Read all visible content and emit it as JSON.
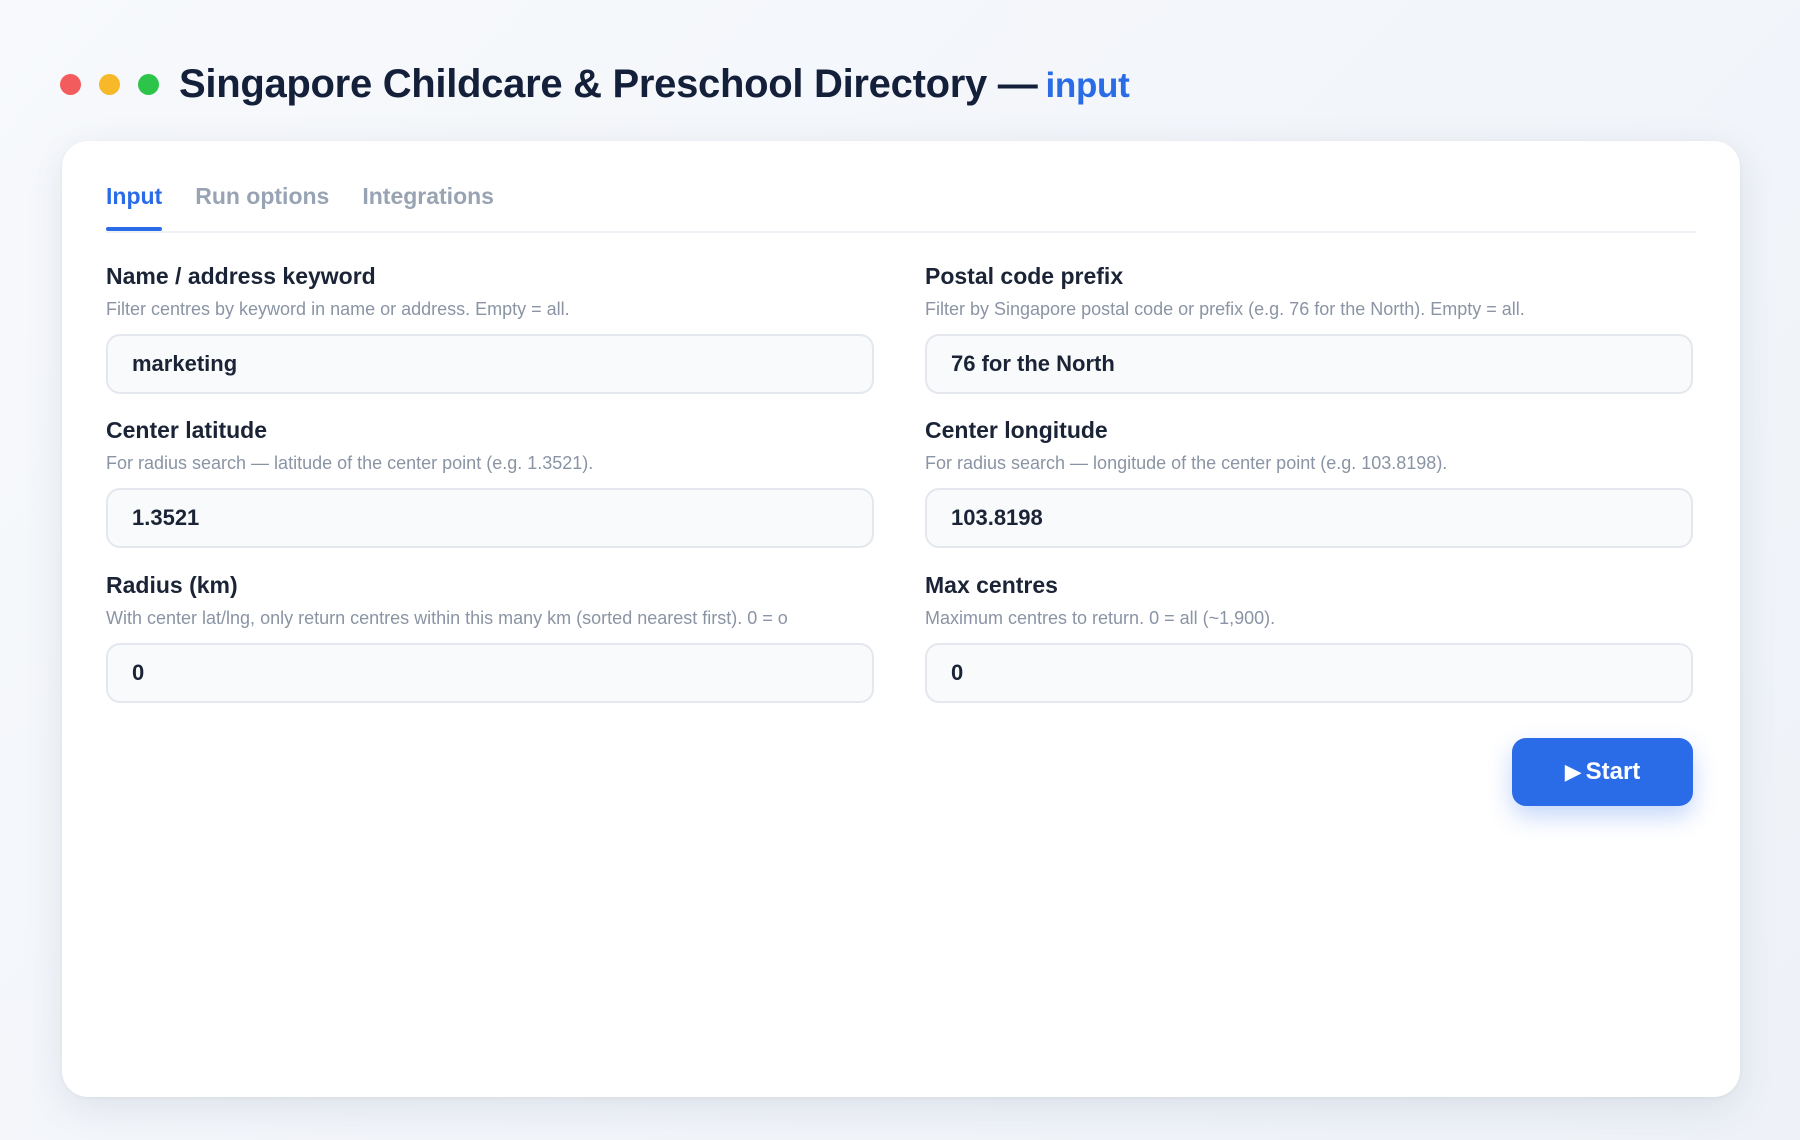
{
  "window": {
    "title": "Singapore Childcare & Preschool Directory —",
    "title_suffix": "input"
  },
  "tabs": [
    {
      "label": "Input",
      "active": true
    },
    {
      "label": "Run options",
      "active": false
    },
    {
      "label": "Integrations",
      "active": false
    }
  ],
  "form": {
    "keyword": {
      "label": "Name / address keyword",
      "hint": "Filter centres by keyword in name or address. Empty = all.",
      "value": "marketing"
    },
    "postal": {
      "label": "Postal code prefix",
      "hint": "Filter by Singapore postal code or prefix (e.g. 76 for the North). Empty = all.",
      "value": "76 for the North"
    },
    "latitude": {
      "label": "Center latitude",
      "hint": "For radius search — latitude of the center point (e.g. 1.3521).",
      "value": "1.3521"
    },
    "longitude": {
      "label": "Center longitude",
      "hint": "For radius search — longitude of the center point (e.g. 103.8198).",
      "value": "103.8198"
    },
    "radius": {
      "label": "Radius (km)",
      "hint": "With center lat/lng, only return centres within this many km (sorted nearest first). 0 = o",
      "value": "0"
    },
    "max_centres": {
      "label": "Max centres",
      "hint": "Maximum centres to return. 0 = all (~1,900).",
      "value": "0"
    }
  },
  "actions": {
    "start_icon": "play-icon",
    "start_glyph": "▶",
    "start_label": "Start"
  },
  "colors": {
    "accent": "#2a6be8",
    "dot_red": "#f25c5c",
    "dot_yellow": "#f7b829",
    "dot_green": "#2cc54a"
  }
}
